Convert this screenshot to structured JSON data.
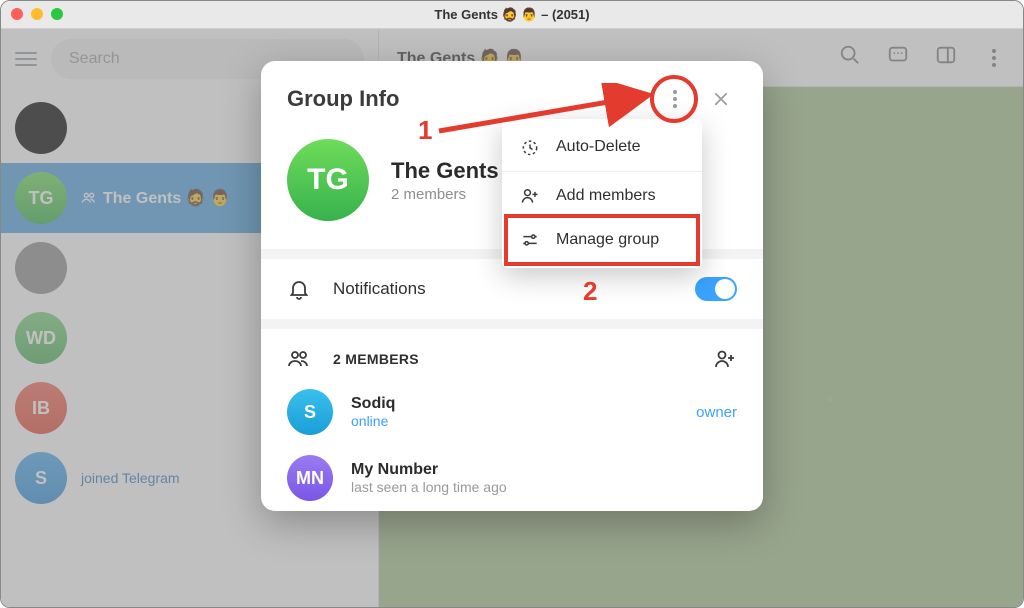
{
  "window": {
    "title": "The Gents 🧔 👨 – (2051)"
  },
  "sidebar": {
    "search_placeholder": "Search",
    "chats": [
      {
        "avatar_text": "",
        "name": "",
        "color": "#000000"
      },
      {
        "avatar_text": "TG",
        "name": "The Gents 🧔 👨",
        "color_a": "#6fdc5a",
        "color_b": "#37b24d",
        "selected": true,
        "group": true,
        "sub": ""
      },
      {
        "avatar_text": "",
        "name": "",
        "color": "#8e8e8e"
      },
      {
        "avatar_text": "WD",
        "name": "",
        "color_a": "#7bd37a",
        "color_b": "#49b05a"
      },
      {
        "avatar_text": "IB",
        "name": "",
        "color_a": "#f46a5a",
        "color_b": "#e24b3a"
      },
      {
        "avatar_text": "S",
        "name": "",
        "color_a": "#49a9ef",
        "color_b": "#2e8edc"
      }
    ],
    "bottom_notice": "joined Telegram"
  },
  "chat_header": {
    "title": "The Gents 🧔 👨"
  },
  "modal": {
    "title": "Group Info",
    "group": {
      "avatar_text": "TG",
      "name": "The Gents",
      "subtitle": "2 members"
    },
    "notifications_label": "Notifications",
    "members_label": "2 MEMBERS",
    "members": [
      {
        "avatar_text": "S",
        "name": "Sodiq",
        "status": "online",
        "role": "owner",
        "color_a": "#39c0ed",
        "color_b": "#1a9ed8",
        "online": true
      },
      {
        "avatar_text": "MN",
        "name": "My Number",
        "status": "last seen a long time ago",
        "color_a": "#9a7cf0",
        "color_b": "#7a56e6",
        "online": false
      }
    ]
  },
  "menu": {
    "items": [
      {
        "label": "Auto-Delete",
        "icon": "timer"
      },
      {
        "label": "Add members",
        "icon": "add-user"
      },
      {
        "label": "Manage group",
        "icon": "sliders"
      }
    ]
  },
  "annotations": {
    "one": "1",
    "two": "2"
  }
}
